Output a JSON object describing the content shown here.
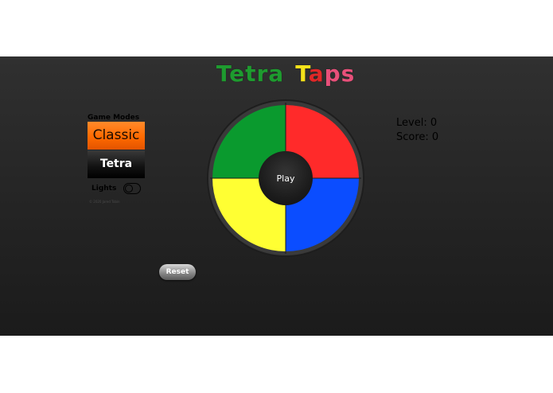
{
  "title": {
    "letters": [
      {
        "char": "T",
        "color": "#1e9b2f"
      },
      {
        "char": "e",
        "color": "#1e9b2f"
      },
      {
        "char": "t",
        "color": "#1e9b2f"
      },
      {
        "char": "r",
        "color": "#1e9b2f"
      },
      {
        "char": "a",
        "color": "#1e9b2f"
      },
      {
        "char": " ",
        "color": "#ffffff"
      },
      {
        "char": "T",
        "color": "#f4e21a"
      },
      {
        "char": "a",
        "color": "#e02828"
      },
      {
        "char": "p",
        "color": "#e8507a"
      },
      {
        "char": "s",
        "color": "#e8507a"
      }
    ]
  },
  "sidebar": {
    "modes_label": "Game Modes",
    "classic_label": "Classic",
    "tetra_label": "Tetra",
    "lights_label": "Lights",
    "copyright": "© 2020 Jared Tobin"
  },
  "wheel": {
    "play_label": "Play",
    "quadrants": [
      {
        "name": "green",
        "color": "#0a9a2e"
      },
      {
        "name": "red",
        "color": "#ff2a2a"
      },
      {
        "name": "blue",
        "color": "#0b4dff"
      },
      {
        "name": "yellow",
        "color": "#ffff33"
      }
    ],
    "ring_color": "#2e2e2e"
  },
  "stats": {
    "level_text": "Level: 0",
    "score_text": "Score: 0"
  },
  "controls": {
    "reset_label": "Reset"
  },
  "colors": {
    "accent": "#ff6a00",
    "stage_bg": "#262626"
  }
}
